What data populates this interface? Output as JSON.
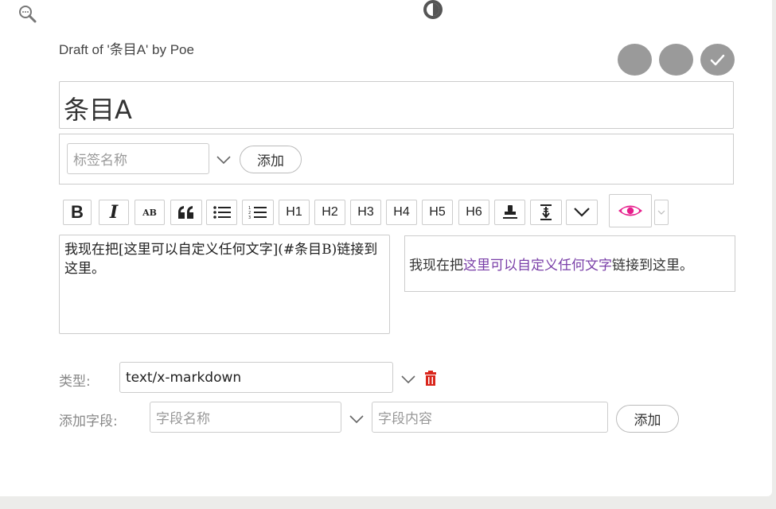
{
  "header": {
    "draft_title": "Draft of '条目A' by Poe"
  },
  "tiddler": {
    "title": "条目A"
  },
  "tags": {
    "tag_placeholder": "标签名称",
    "add_label": "添加"
  },
  "toolbar": {
    "bold": "B",
    "italic": "I",
    "strike": "AB",
    "quote": "66",
    "h1": "H1",
    "h2": "H2",
    "h3": "H3",
    "h4": "H4",
    "h5": "H5",
    "h6": "H6"
  },
  "editor": {
    "body_text": "我现在把[这里可以自定义任何文字](#条目B)链接到这里。"
  },
  "preview": {
    "text_before": "我现在把",
    "link_text": "这里可以自定义任何文字",
    "text_after": "链接到这里。"
  },
  "type_field": {
    "label": "类型:",
    "value": "text/x-markdown"
  },
  "add_field": {
    "label": "添加字段:",
    "name_placeholder": "字段名称",
    "value_placeholder": "字段内容",
    "add_label": "添加"
  },
  "colors": {
    "preview_toggle": "#e61e8c",
    "link": "#7a3fa8",
    "delete": "#d9261c",
    "circle_buttons": "#9a9a9a"
  }
}
